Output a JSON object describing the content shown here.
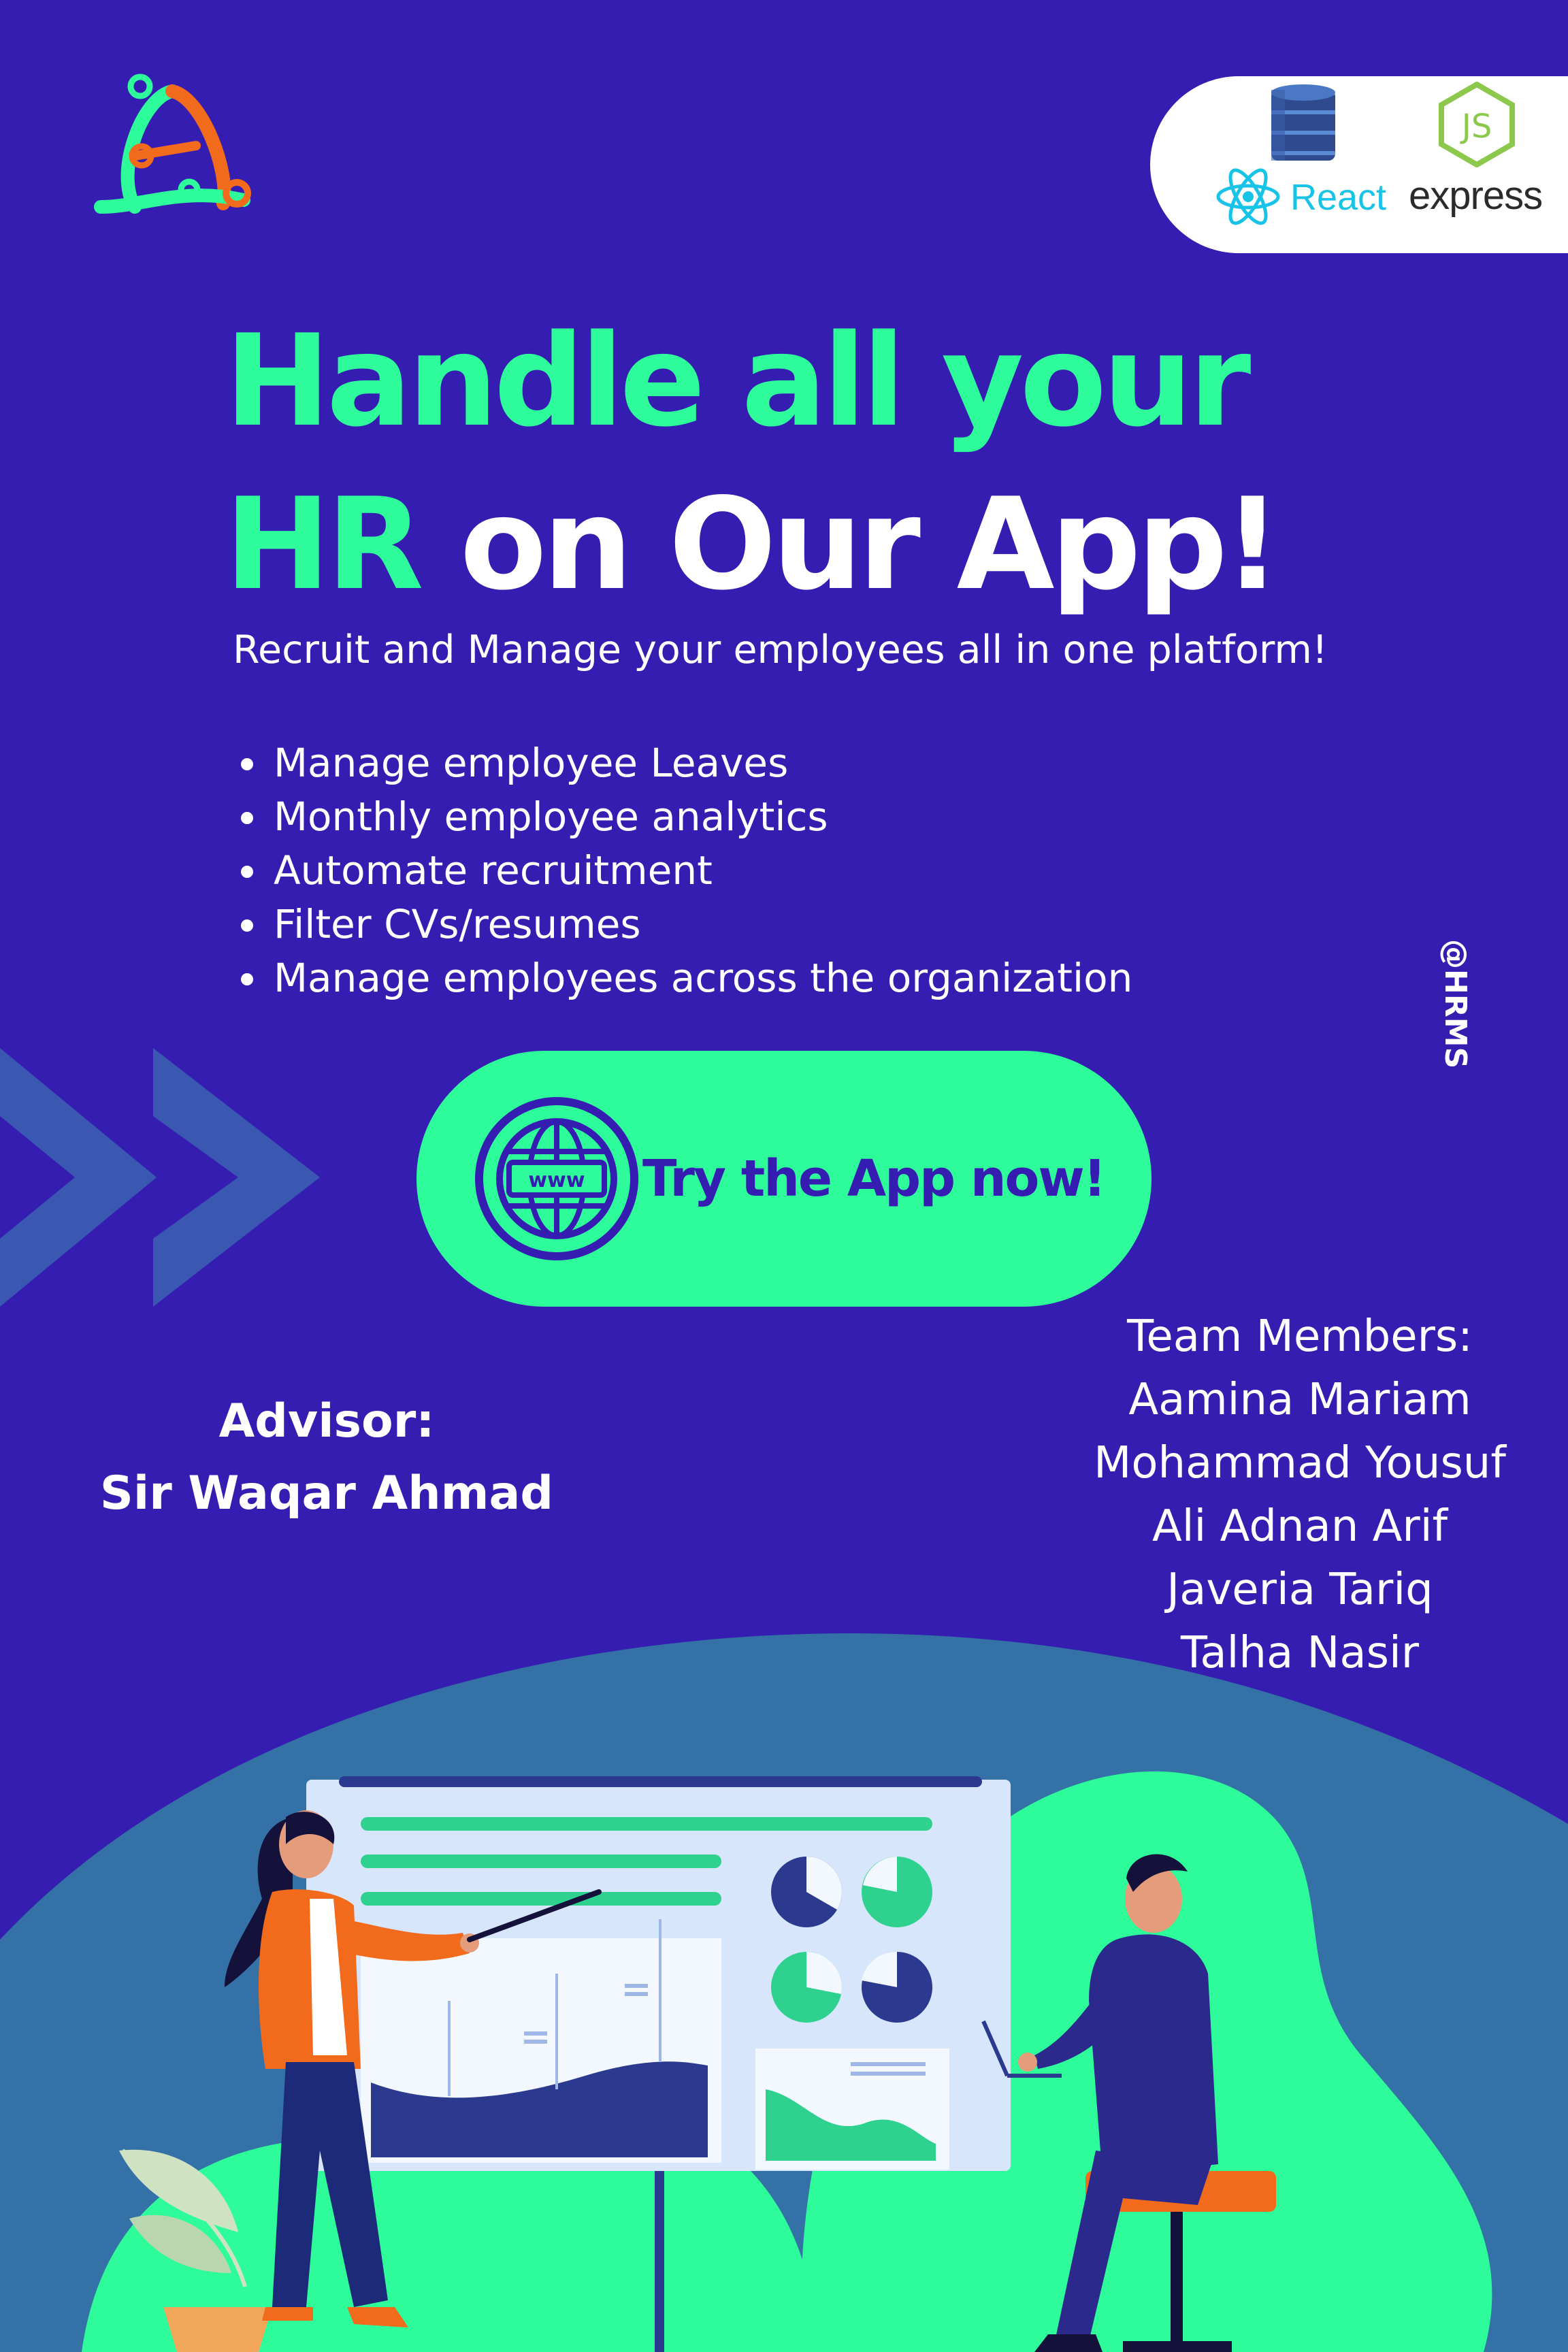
{
  "brand": {
    "logo_icon": "hrms-logo-icon",
    "tech_badge": {
      "icons": [
        "database-icon",
        "react-icon",
        "nodejs-icon"
      ],
      "react_label": "React",
      "express_label": "express",
      "js_label": "JS"
    }
  },
  "hero": {
    "line1": "Handle all your",
    "line2_accent": "HR",
    "line2_rest": " on Our App!",
    "subtitle": "Recruit and Manage your employees  all in one platform!"
  },
  "features": [
    "Manage employee Leaves",
    "Monthly employee analytics",
    "Automate recruitment",
    "Filter CVs/resumes",
    "Manage employees across the organization"
  ],
  "social_handle": "@HRMS",
  "cta": {
    "label": "Try the App now!",
    "icon": "globe-www-icon",
    "icon_text": "www"
  },
  "advisor": {
    "heading": "Advisor:",
    "name": "Sir Waqar Ahmad"
  },
  "team": {
    "heading": "Team Members:",
    "members": [
      "Aamina Mariam",
      "Mohammad Yousuf",
      "Ali Adnan Arif",
      "Javeria Tariq",
      "Talha Nasir"
    ]
  },
  "colors": {
    "background": "#361db2",
    "accent_green": "#2efc9a",
    "accent_orange": "#f26a1b",
    "react_blue": "#17c3e6",
    "js_green": "#8cc84b",
    "hill_blue": "#3471a6"
  }
}
